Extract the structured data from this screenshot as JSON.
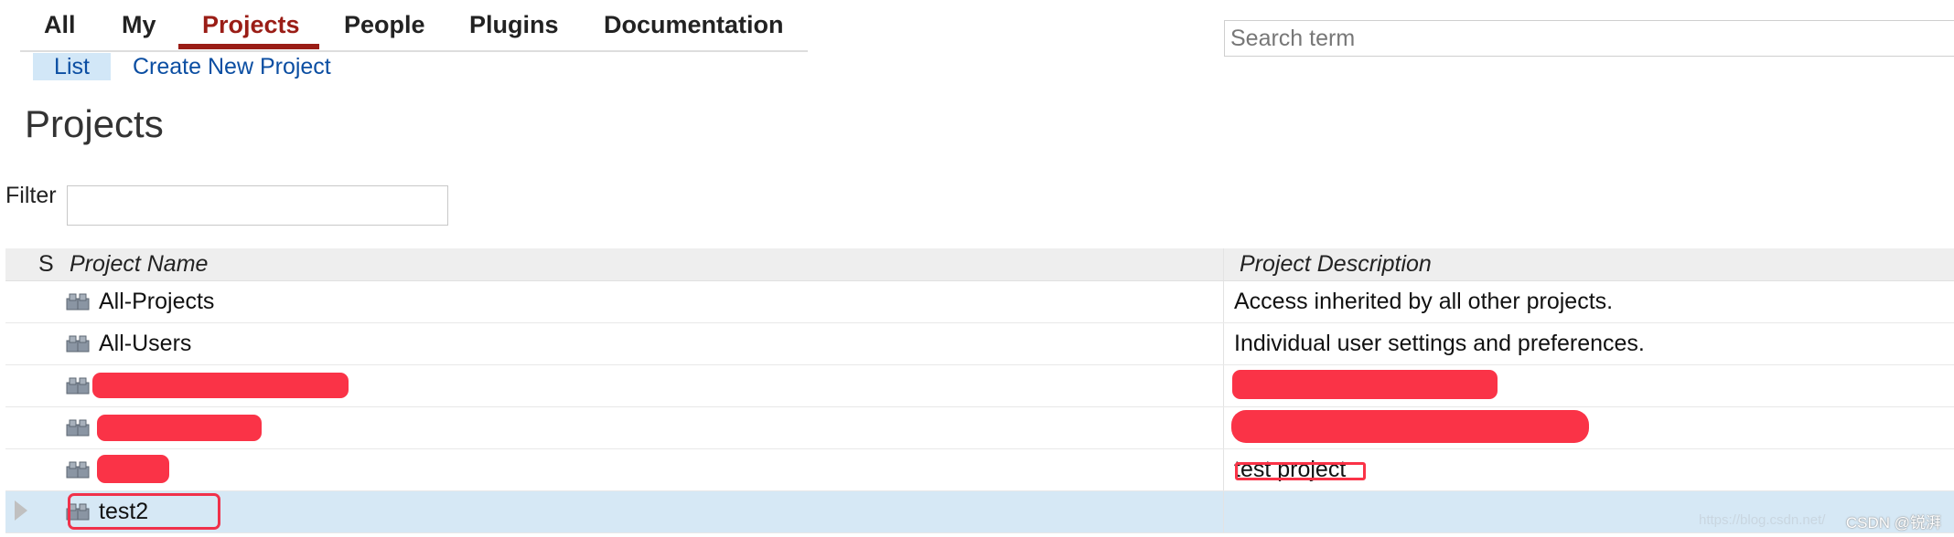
{
  "top_nav": {
    "tabs": [
      {
        "label": "All"
      },
      {
        "label": "My"
      },
      {
        "label": "Projects"
      },
      {
        "label": "People"
      },
      {
        "label": "Plugins"
      },
      {
        "label": "Documentation"
      }
    ],
    "active": "Projects"
  },
  "sub_nav": {
    "list_label": "List",
    "create_label": "Create New Project"
  },
  "search": {
    "placeholder": "Search term"
  },
  "page_title": "Projects",
  "filter": {
    "label": "Filter",
    "value": ""
  },
  "table": {
    "columns": {
      "state": "S",
      "name": "Project Name",
      "description": "Project Description"
    },
    "rows": [
      {
        "name": "All-Projects",
        "description": "Access inherited by all other projects."
      },
      {
        "name": "All-Users",
        "description": "Individual user settings and preferences."
      },
      {
        "name": "",
        "description": ""
      },
      {
        "name": "",
        "description": ""
      },
      {
        "name": "",
        "description": "test project"
      },
      {
        "name": "test2",
        "description": ""
      }
    ]
  },
  "watermark": {
    "url": "https://blog.csdn.net/",
    "text": "CSDN @锐湃"
  },
  "colors": {
    "accent": "#9a1d16",
    "link": "#0b4ea2",
    "selected_row": "#d6e8f5",
    "redaction": "#fa3347"
  }
}
